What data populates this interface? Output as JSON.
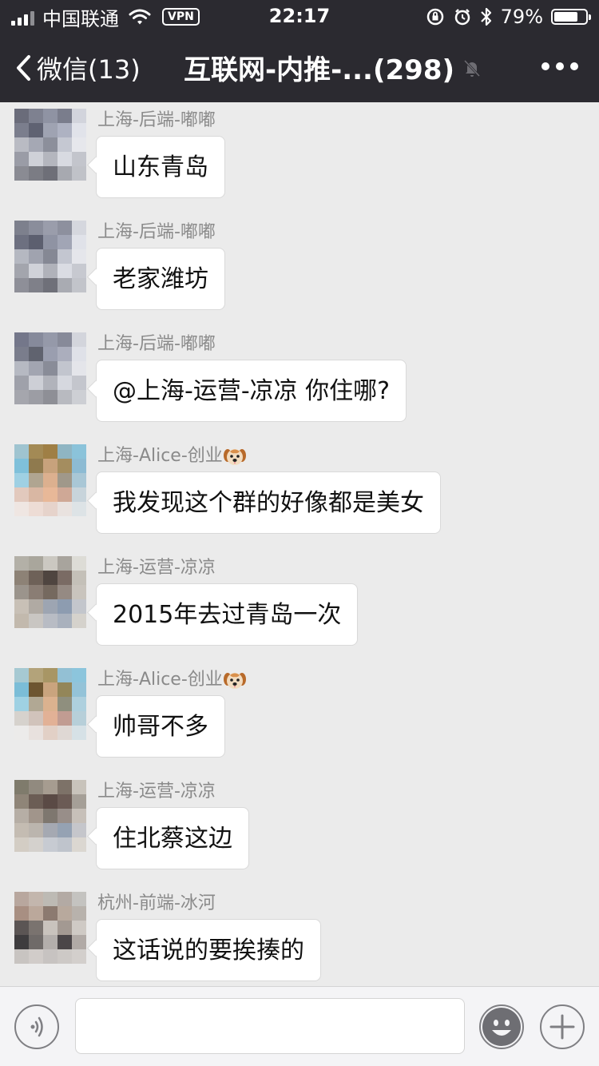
{
  "status_bar": {
    "carrier": "中国联通",
    "vpn": "VPN",
    "time": "22:17",
    "battery": "79%",
    "battery_level": 0.79
  },
  "nav": {
    "back_label": "微信(13)",
    "title": "互联网-内推-...(298)"
  },
  "messages": [
    {
      "sender": "上海-后端-嘟嘟",
      "text": "山东青岛",
      "avatar_colors": [
        "#6a6c7a",
        "#7e8190",
        "#8f93a3",
        "#7a7d8c",
        "#d2d4dc",
        "#7b7e8d",
        "#5f6272",
        "#9fa3b2",
        "#aeb2c2",
        "#e1e3ea",
        "#b9bbc3",
        "#a5a8b4",
        "#8c8f9b",
        "#c5c8d2",
        "#e6e7ec",
        "#9a9ca6",
        "#cfd1d8",
        "#b4b6be",
        "#d8dae1",
        "#c3c5cc",
        "#8a8b93",
        "#7b7c84",
        "#6e6f78",
        "#a7a9b0",
        "#c0c2c8"
      ]
    },
    {
      "sender": "上海-后端-嘟嘟",
      "text": "老家潍坊",
      "avatar_colors": [
        "#7d808d",
        "#8a8d9b",
        "#9a9dab",
        "#8d909e",
        "#d5d7de",
        "#6d7080",
        "#5c5f6f",
        "#8f93a3",
        "#a1a5b5",
        "#e0e2e9",
        "#b5b8c1",
        "#a0a3af",
        "#858894",
        "#c3c6d0",
        "#e5e6eb",
        "#a3a5ad",
        "#d0d2d9",
        "#b0b2ba",
        "#dadce3",
        "#c7c9d0",
        "#8e8f98",
        "#7f8089",
        "#6f7079",
        "#a9abb2",
        "#c2c4ca"
      ]
    },
    {
      "sender": "上海-后端-嘟嘟",
      "text": "@上海-运营-凉凉 你住哪?",
      "avatar_colors": [
        "#74778a",
        "#868a9b",
        "#9599a9",
        "#878a99",
        "#d3d5dc",
        "#7a7d8c",
        "#60636f",
        "#9a9eaf",
        "#abaebd",
        "#dfe1e8",
        "#b6b9c2",
        "#a2a5b1",
        "#898c98",
        "#c2c5ce",
        "#e4e5ea",
        "#9fa1aa",
        "#cdcfd6",
        "#b1b3bb",
        "#d6d8df",
        "#c4c6cd",
        "#a5a6ad",
        "#9c9da4",
        "#8e8f96",
        "#b8bac0",
        "#cdcfd4"
      ]
    },
    {
      "sender": "上海-Alice-创业",
      "text": "我发现这个群的好像都是美女",
      "has_dog": true,
      "avatar_colors": [
        "#9fc4d0",
        "#a38a55",
        "#9f7f45",
        "#8fb5c3",
        "#8bc3da",
        "#7fc0da",
        "#8f7a4e",
        "#c7a27c",
        "#a48d5f",
        "#8dbbd3",
        "#9fd0e3",
        "#b0a591",
        "#dcb08f",
        "#a0988a",
        "#a9c7d6",
        "#e2c9bd",
        "#d9b7a3",
        "#e8b898",
        "#cfa896",
        "#c8d4db",
        "#efe6e2",
        "#eddcd5",
        "#e6d3cb",
        "#e9e2df",
        "#dde3e6"
      ]
    },
    {
      "sender": "上海-运营-凉凉",
      "text": "2015年去过青岛一次",
      "avatar_colors": [
        "#b3b0a7",
        "#a9a69c",
        "#cbc8c1",
        "#a8a49d",
        "#dddcd6",
        "#8d8276",
        "#6e6158",
        "#4f4540",
        "#7a6b64",
        "#c4c0b8",
        "#9b948c",
        "#8a7d74",
        "#75695f",
        "#958a83",
        "#c9c4bd",
        "#c8c0b6",
        "#b0aaa3",
        "#9da5b2",
        "#8d9cb0",
        "#c3c6cc",
        "#c2b9ad",
        "#c9c6c2",
        "#b8bcc4",
        "#a9b1bd",
        "#d5d2cc"
      ]
    },
    {
      "sender": "上海-Alice-创业",
      "text": "帅哥不多",
      "has_dog": true,
      "avatar_colors": [
        "#a6c9d2",
        "#b3a37a",
        "#a89665",
        "#93c0d4",
        "#8cc5dc",
        "#7bbdd7",
        "#6d5530",
        "#c9a47e",
        "#938659",
        "#94c3d8",
        "#9fd1e3",
        "#b1a894",
        "#dbb28f",
        "#8f8f7e",
        "#aed0de",
        "#d6d2cd",
        "#d1c3bb",
        "#e2b196",
        "#c19c92",
        "#b7cfd9",
        "#ecebea",
        "#e8e1de",
        "#e2d0c6",
        "#dfd8d4",
        "#d6e1e6"
      ]
    },
    {
      "sender": "上海-运营-凉凉",
      "text": "住北蔡这边",
      "avatar_colors": [
        "#7f7b6c",
        "#918a7f",
        "#a69c90",
        "#7d7268",
        "#c8c3bb",
        "#8f8578",
        "#6b5d55",
        "#5a4a45",
        "#6b5b55",
        "#a59f97",
        "#b6aea5",
        "#a1958b",
        "#7e776f",
        "#988e89",
        "#c7c0b9",
        "#c4bcb2",
        "#bbb5ae",
        "#a5a9b2",
        "#95a2b3",
        "#c5c6cb",
        "#d3cdc4",
        "#d4d1cd",
        "#c7cbd2",
        "#bfc4cc",
        "#dbd7d1"
      ]
    },
    {
      "sender": "杭州-前端-冰河",
      "text": "这话说的要挨揍的",
      "avatar_colors": [
        "#b8a79e",
        "#c3b6ad",
        "#bdbab4",
        "#b3aaa4",
        "#c4c3c0",
        "#a88f82",
        "#bba89b",
        "#8c7a70",
        "#b8a99d",
        "#b8b2ac",
        "#5b5554",
        "#7a736f",
        "#c9c3bd",
        "#a39992",
        "#cfcac5",
        "#3e3c3e",
        "#6f6a68",
        "#b3aeab",
        "#4b4648",
        "#b1aaa6",
        "#c8c4c1",
        "#d1ccc9",
        "#c7c3c1",
        "#cdc9c6",
        "#d3cfcc"
      ]
    }
  ],
  "input_bar": {
    "voice_icon": "voice-icon",
    "emoji_icon": "emoji-icon",
    "plus_icon": "plus-icon"
  }
}
